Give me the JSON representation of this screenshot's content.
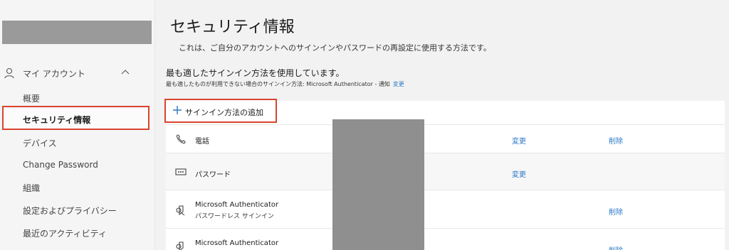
{
  "sidebar": {
    "account_label": "マイ アカウント",
    "items": [
      {
        "label": "概要"
      },
      {
        "label": "セキュリティ情報",
        "selected": true
      },
      {
        "label": "デバイス"
      },
      {
        "label": "Change Password"
      },
      {
        "label": "組織"
      },
      {
        "label": "設定およびプライバシー"
      },
      {
        "label": "最近のアクティビティ"
      }
    ]
  },
  "main": {
    "title": "セキュリティ情報",
    "description": "これは、ご自分のアカウントへのサインインやパスワードの再設定に使用する方法です。",
    "default_heading": "最も適したサインイン方法を使用しています。",
    "default_sub": "最も適したものが利用できない場合のサインイン方法: Microsoft Authenticator - 通知",
    "default_change": "変更",
    "add_method_label": "サインイン方法の追加",
    "methods": [
      {
        "icon": "phone-icon",
        "name": "電話",
        "sub": "",
        "change": "変更",
        "delete": "削除"
      },
      {
        "icon": "password-dots-icon",
        "name": "パスワード",
        "sub": "",
        "change": "変更",
        "delete": ""
      },
      {
        "icon": "authenticator-icon",
        "name": "Microsoft Authenticator",
        "sub": "パスワードレス サインイン",
        "change": "",
        "delete": "削除"
      },
      {
        "icon": "authenticator-icon",
        "name": "Microsoft Authenticator",
        "sub": "",
        "change": "",
        "delete": "削除"
      }
    ]
  },
  "colors": {
    "accent_link": "#2b78c7",
    "highlight_border": "#d9432f",
    "redaction": "#8f8f8f"
  }
}
